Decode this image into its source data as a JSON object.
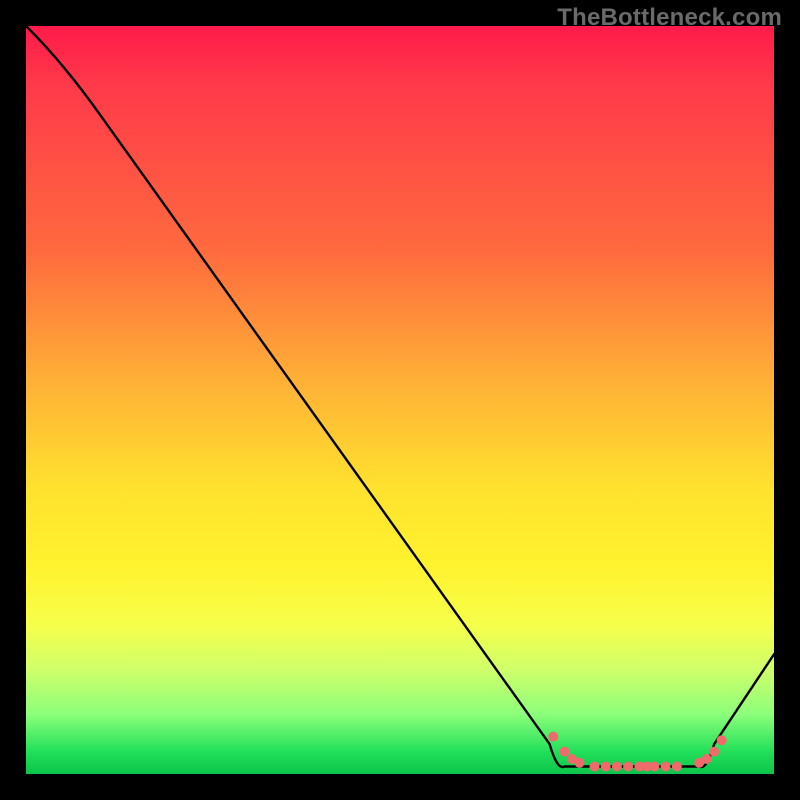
{
  "watermark": "TheBottleneck.com",
  "chart_data": {
    "type": "line",
    "title": "",
    "xlabel": "",
    "ylabel": "",
    "xlim": [
      0,
      100
    ],
    "ylim": [
      0,
      100
    ],
    "grid": false,
    "legend": false,
    "series": [
      {
        "name": "curve",
        "x": [
          0,
          10,
          70,
          72,
          90,
          92,
          100
        ],
        "y": [
          100,
          88,
          4,
          1,
          1,
          4,
          16
        ],
        "color": "#000000"
      }
    ],
    "markers": {
      "name": "dots",
      "color": "#ef6a6a",
      "radius": 5,
      "points": [
        {
          "x": 70.5,
          "y": 5
        },
        {
          "x": 72,
          "y": 3
        },
        {
          "x": 73,
          "y": 2
        },
        {
          "x": 74,
          "y": 1.5
        },
        {
          "x": 76,
          "y": 1
        },
        {
          "x": 77.5,
          "y": 1
        },
        {
          "x": 79,
          "y": 1
        },
        {
          "x": 80.5,
          "y": 1
        },
        {
          "x": 82,
          "y": 1
        },
        {
          "x": 83,
          "y": 1
        },
        {
          "x": 84,
          "y": 1
        },
        {
          "x": 85.5,
          "y": 1
        },
        {
          "x": 87,
          "y": 1
        },
        {
          "x": 90,
          "y": 1.5
        },
        {
          "x": 91,
          "y": 2
        },
        {
          "x": 92,
          "y": 3
        },
        {
          "x": 93,
          "y": 4.5
        }
      ]
    },
    "gradient_stops": [
      {
        "pos": 0.0,
        "color": "#ff1a4a"
      },
      {
        "pos": 0.3,
        "color": "#ff6a3e"
      },
      {
        "pos": 0.62,
        "color": "#ffe22e"
      },
      {
        "pos": 0.86,
        "color": "#d0ff6a"
      },
      {
        "pos": 1.0,
        "color": "#0cc44a"
      }
    ]
  }
}
